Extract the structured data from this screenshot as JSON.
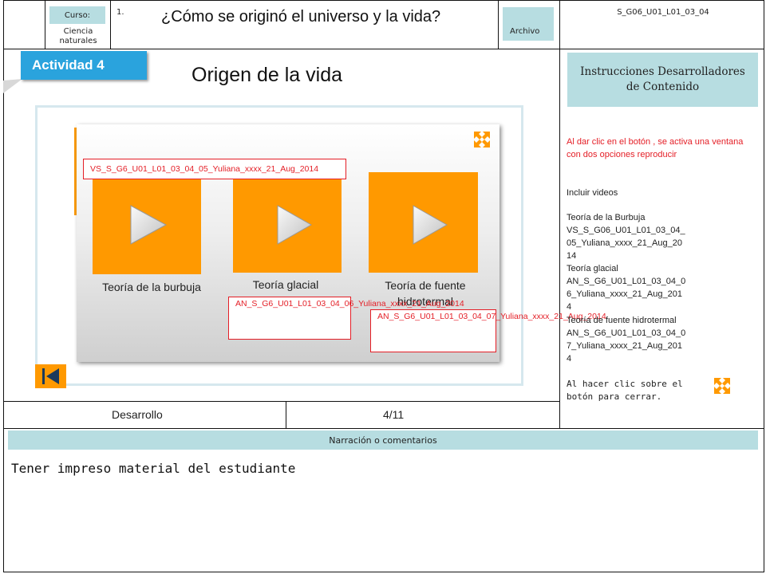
{
  "header": {
    "curso_label": "Curso:",
    "curso_value": "Ciencia naturales",
    "number": "1.",
    "question": "¿Cómo se originó el universo y la vida?",
    "archivo_label": "Archivo",
    "code": "S_G06_U01_L01_03_04"
  },
  "activity": {
    "badge": "Actividad 4",
    "title": "Origen de la vida"
  },
  "videos": [
    {
      "caption": "Teoría de la burbuja",
      "code": "VS_S_G6_U01_L01_03_04_05_Yuliana_xxxx_21_Aug_2014"
    },
    {
      "caption": "Teoría glacial",
      "code": "AN_S_G6_U01_L01_03_04_06_Yuliana_xxxx_21_Aug_2014"
    },
    {
      "caption": "Teoría de fuente hidrotermal",
      "code": "AN_S_G6_U01_L01_03_04_07_Yuliana_xxxx_21_Aug_2014"
    }
  ],
  "footer": {
    "phase": "Desarrollo",
    "page": "4/11"
  },
  "instructions": {
    "header": "Instrucciones Desarrolladores de Contenido",
    "red_text": "Al dar clic en el botón , se activa una ventana con dos  opciones reproducir",
    "include": "Incluir videos",
    "t1_name": "Teoría de la Burbuja",
    "t1_code": "VS_S_G06_U01_L01_03_04_05_Yuliana_xxxx_21_Aug_2014",
    "t2_name": "Teoría glacial",
    "t2_code": "AN_S_G6_U01_L01_03_04_06_Yuliana_xxxx_21_Aug_2014",
    "t3_name": "Teoría de fuente hidrotermal",
    "t3_code": "AN_S_G6_U01_L01_03_04_07_Yuliana_xxxx_21_Aug_2014",
    "close_text": "Al hacer clic sobre el botón para cerrar."
  },
  "narration": {
    "header": "Narración o comentarios",
    "text": "Tener impreso material del estudiante"
  },
  "colors": {
    "accent": "#ff9900",
    "teal": "#b7dde1",
    "annotation": "#e41e26",
    "frame": "#d6e8ee"
  }
}
